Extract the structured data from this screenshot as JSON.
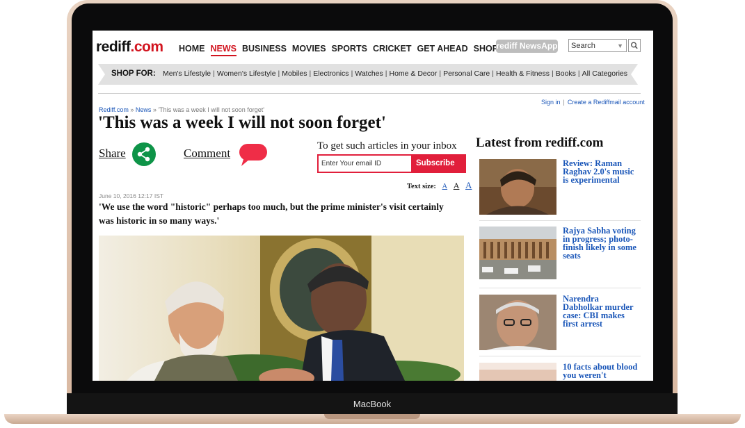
{
  "device": {
    "brand": "MacBook"
  },
  "header": {
    "logo": {
      "main": "rediff",
      "suffix": ".com"
    },
    "nav": [
      "HOME",
      "NEWS",
      "BUSINESS",
      "MOVIES",
      "SPORTS",
      "CRICKET",
      "GET AHEAD",
      "SHOPPING"
    ],
    "active_nav": "NEWS",
    "app_button": "rediff NewsApp",
    "search_placeholder": "Search"
  },
  "shop": {
    "label": "SHOP FOR:",
    "links": [
      "Men's Lifestyle",
      "Women's Lifestyle",
      "Mobiles",
      "Electronics",
      "Watches",
      "Home & Decor",
      "Personal Care",
      "Health & Fitness",
      "Books",
      "All Categories"
    ]
  },
  "account": {
    "sign_in": "Sign in",
    "separator": "|",
    "create": "Create a Rediffmail account"
  },
  "article": {
    "breadcrumb": {
      "home": "Rediff.com",
      "sep": "»",
      "section": "News",
      "current": "'This was a week I will not soon forget'"
    },
    "title": "'This was a week I will not soon forget'",
    "share_label": "Share",
    "comment_label": "Comment",
    "inbox_label": "To get such articles in your inbox",
    "email_placeholder": "Enter Your email ID",
    "subscribe_label": "Subscribe",
    "text_size_label": "Text size:",
    "text_size_options": [
      "A",
      "A",
      "A"
    ],
    "date": "June 10, 2016 12:17 IST",
    "standfirst": "'We use the word \"historic\" perhaps too much, but the prime minister's visit certainly was historic in so many ways.'"
  },
  "sidebar": {
    "title": "Latest from rediff.com",
    "stories": [
      {
        "title": "Review: Raman Raghav 2.0's music is experimental"
      },
      {
        "title": "Rajya Sabha voting in progress; photo-finish likely in some seats"
      },
      {
        "title": "Narendra Dabholkar murder case: CBI makes first arrest"
      },
      {
        "title": "10 facts about blood you weren't"
      }
    ]
  },
  "colors": {
    "brand_red": "#d2141f",
    "link_blue": "#1a56b8",
    "share_green": "#0e9448",
    "subscribe_red": "#e11f3b"
  }
}
